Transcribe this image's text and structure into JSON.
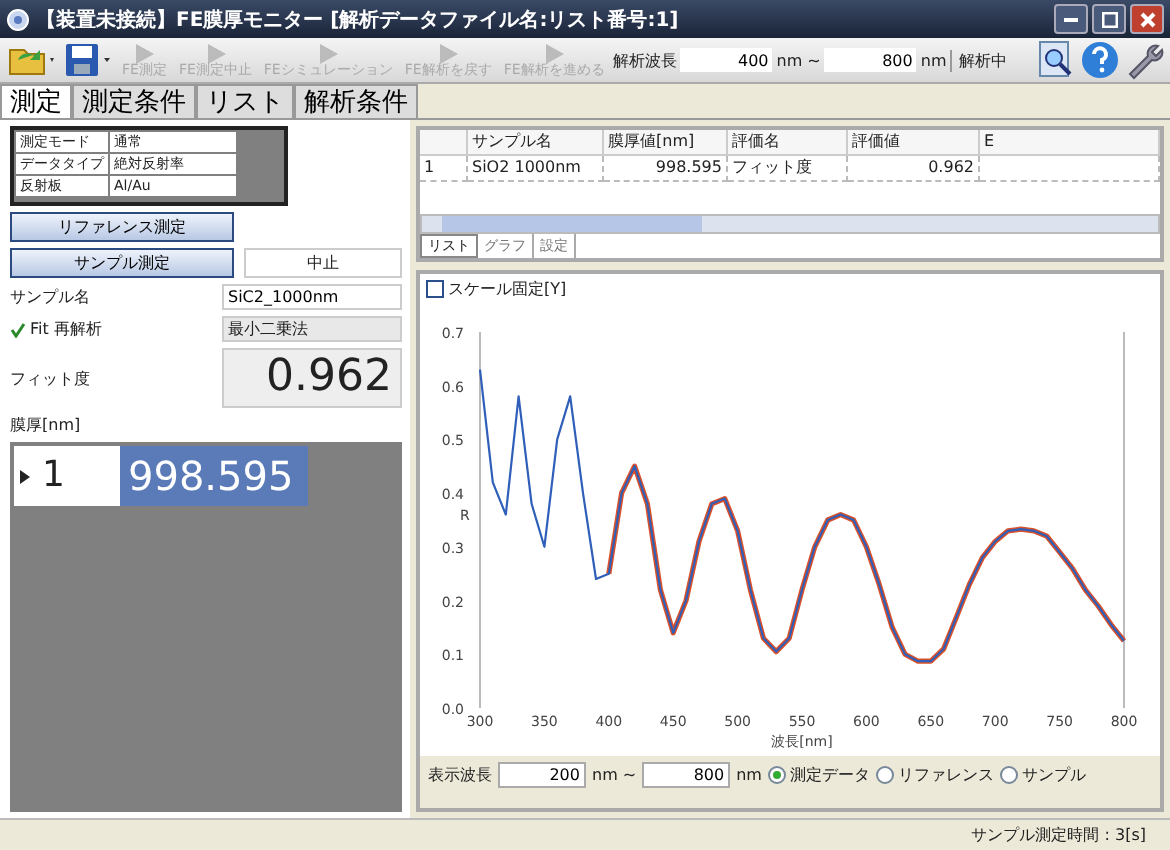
{
  "window": {
    "title": "【装置未接続】FE膜厚モニター [解析データファイル名:リスト番号:1]"
  },
  "toolbar": {
    "buttons": [
      {
        "label": "FE測定",
        "disabled": true
      },
      {
        "label": "FE測定中止",
        "disabled": true
      },
      {
        "label": "FEシミュレーション",
        "disabled": true
      },
      {
        "label": "FE解析を戻す",
        "disabled": true
      },
      {
        "label": "FE解析を進める",
        "disabled": true
      }
    ],
    "range_label": "解析波長",
    "range_from": "400",
    "range_to": "800",
    "unit_from": "nm ~",
    "unit_to": "nm",
    "status": "解析中"
  },
  "tabs": [
    {
      "label": "測定",
      "selected": true
    },
    {
      "label": "測定条件",
      "selected": false
    },
    {
      "label": "リスト",
      "selected": false
    },
    {
      "label": "解析条件",
      "selected": false
    }
  ],
  "info": [
    {
      "label": "測定モード",
      "value": "通常"
    },
    {
      "label": "データタイプ",
      "value": "絶対反射率"
    },
    {
      "label": "反射板",
      "value": "Al/Au"
    }
  ],
  "reference_button": "リファレンス測定",
  "sample_button": "サンプル測定",
  "run_state": "中止",
  "sample_name_label": "サンプル名",
  "sample_name": "SiC2_1000nm",
  "fit": {
    "label": "Fit 再解析",
    "checked": true,
    "method": "最小二乗法"
  },
  "fit_degree_label": "フィット度",
  "fit_degree": "0.962",
  "thickness_label": "膜厚[nm]",
  "thickness_rows": [
    {
      "index": "1",
      "value": "998.595"
    }
  ],
  "table": {
    "columns": [
      "",
      "サンプル名",
      "膜厚値[nm]",
      "評価名",
      "評価値",
      "E"
    ],
    "rows": [
      [
        "1",
        "SiO2 1000nm",
        "998.595",
        "フィット度",
        "0.962"
      ]
    ],
    "tabs": [
      {
        "label": "リスト",
        "selected": true
      },
      {
        "label": "グラフ",
        "selected": false
      },
      {
        "label": "設定",
        "selected": false
      }
    ]
  },
  "graph": {
    "scale_fixed": {
      "label": "スケール固定[Y]",
      "checked": false
    },
    "chart_data": {
      "type": "line",
      "xlabel": "波長[nm]",
      "ylabel": "R",
      "x": [
        300,
        310,
        320,
        330,
        340,
        350,
        360,
        370,
        380,
        390,
        400,
        410,
        420,
        430,
        440,
        450,
        460,
        470,
        480,
        490,
        500,
        510,
        520,
        530,
        540,
        550,
        560,
        570,
        580,
        590,
        600,
        610,
        620,
        630,
        640,
        650,
        660,
        670,
        680,
        690,
        700,
        710,
        720,
        730,
        740,
        750,
        760,
        770,
        780,
        790,
        800
      ],
      "series": [
        {
          "color": "#2f5fb8",
          "values": [
            0.63,
            0.42,
            0.36,
            0.58,
            0.38,
            0.3,
            0.5,
            0.58,
            0.4,
            0.24,
            0.25,
            0.4,
            0.45,
            0.38,
            0.22,
            0.14,
            0.2,
            0.31,
            0.38,
            0.39,
            0.33,
            0.22,
            0.13,
            0.105,
            0.13,
            0.22,
            0.3,
            0.35,
            0.36,
            0.35,
            0.3,
            0.23,
            0.15,
            0.1,
            0.087,
            0.087,
            0.11,
            0.17,
            0.23,
            0.28,
            0.31,
            0.33,
            0.333,
            0.33,
            0.32,
            0.29,
            0.26,
            0.22,
            0.19,
            0.155,
            0.125
          ]
        },
        {
          "color": "#d9502a",
          "values": [
            null,
            null,
            null,
            null,
            null,
            null,
            null,
            null,
            null,
            null,
            0.25,
            0.4,
            0.45,
            0.38,
            0.22,
            0.14,
            0.2,
            0.31,
            0.38,
            0.39,
            0.33,
            0.22,
            0.13,
            0.105,
            0.13,
            0.22,
            0.3,
            0.35,
            0.36,
            0.35,
            0.3,
            0.23,
            0.15,
            0.1,
            0.087,
            0.087,
            0.11,
            0.17,
            0.23,
            0.28,
            0.31,
            0.33,
            0.333,
            0.33,
            0.32,
            0.29,
            0.26,
            0.22,
            0.19,
            0.155,
            0.125
          ]
        }
      ],
      "xlim": [
        300,
        800
      ],
      "ylim": [
        0,
        0.7
      ],
      "xticks": [
        300,
        350,
        400,
        450,
        500,
        550,
        600,
        650,
        700,
        750,
        800
      ],
      "yticks": [
        {
          "value": 0,
          "label": "0.0"
        },
        0.1,
        0.2,
        0.3,
        0.4,
        0.5,
        0.6,
        0.7
      ]
    },
    "display_label": "表示波長",
    "display_from": "200",
    "display_to": "800",
    "unit_from": "nm ~",
    "unit_to": "nm",
    "radios": [
      {
        "label": "測定データ",
        "selected": true
      },
      {
        "label": "リファレンス",
        "selected": false
      },
      {
        "label": "サンプル",
        "selected": false
      }
    ]
  },
  "status_bar": "サンプル測定時間 : 3[s]"
}
